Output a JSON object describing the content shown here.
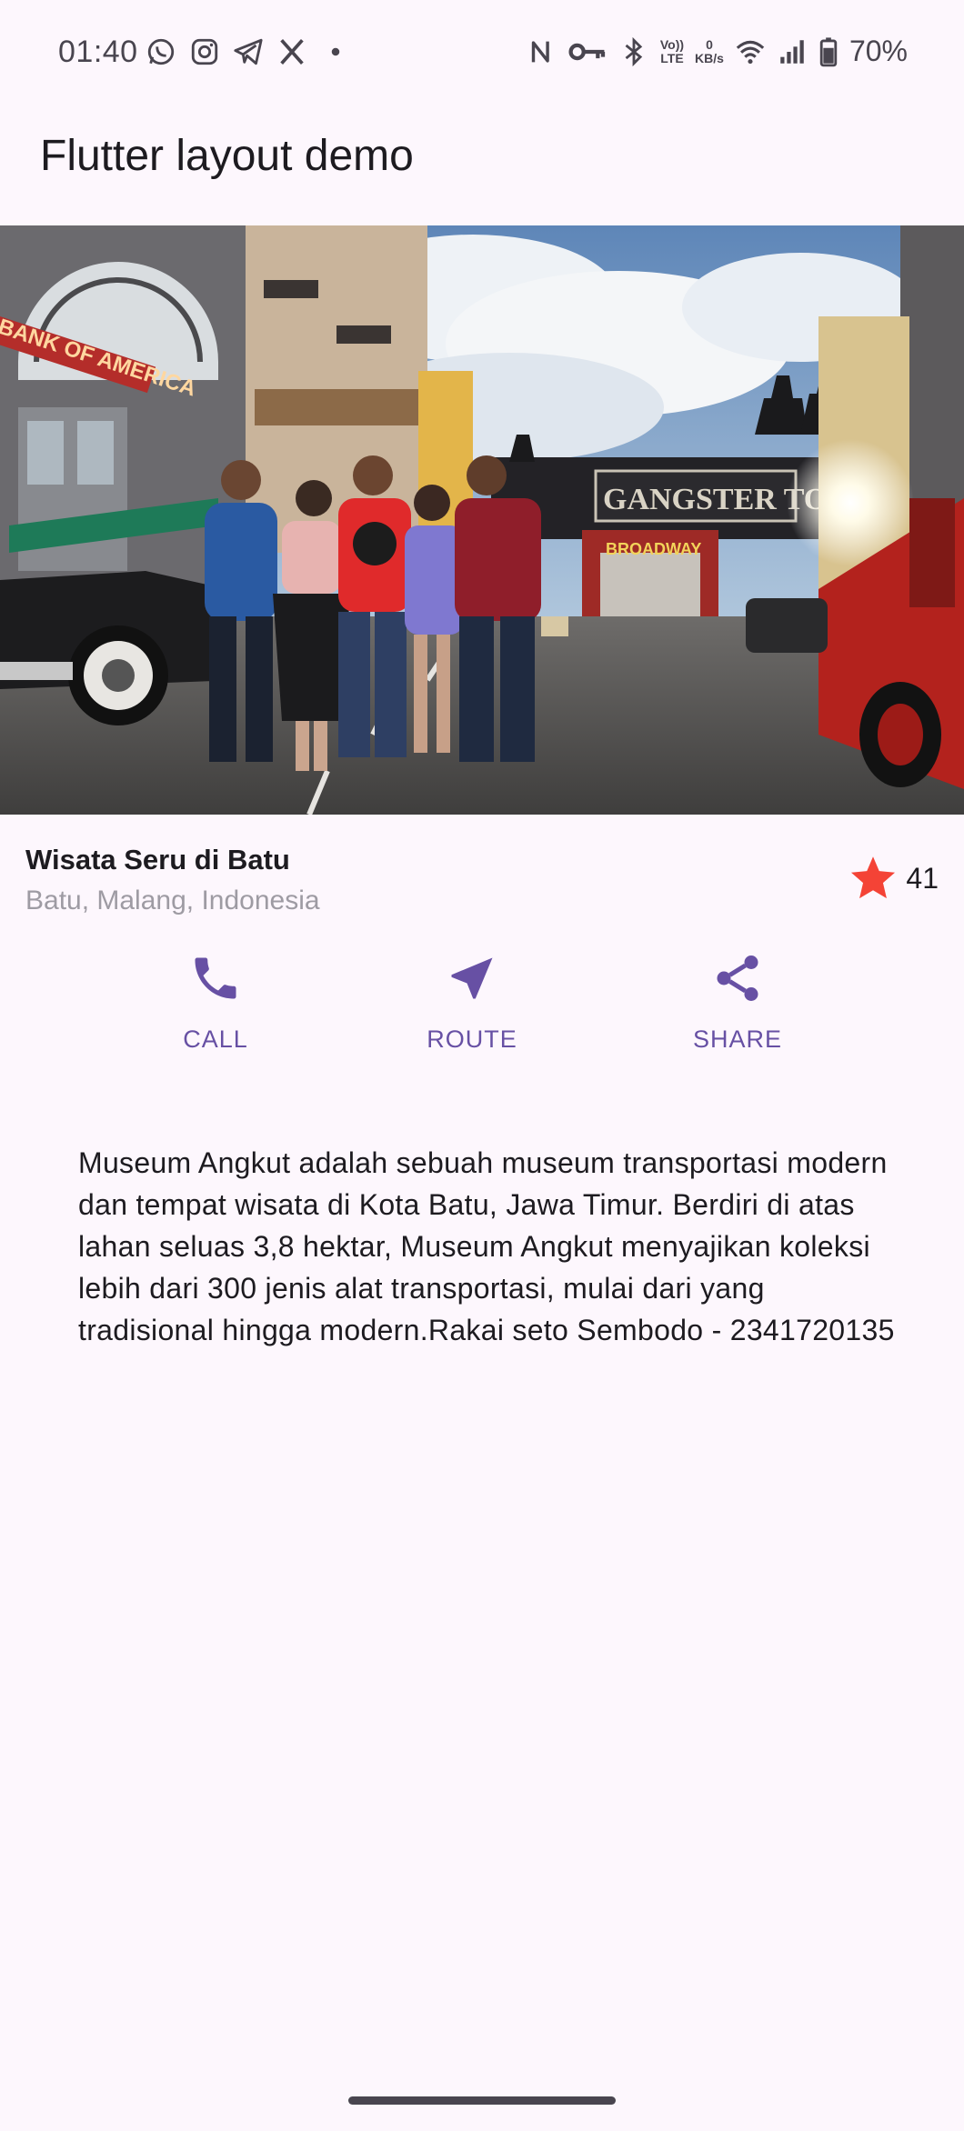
{
  "status_bar": {
    "time": "01:40",
    "battery": "70%",
    "data_rate_value": "0",
    "data_rate_unit": "KB/s",
    "volte_top": "Vo))",
    "volte_bottom": "LTE",
    "left_icons": [
      "whatsapp-icon",
      "instagram-icon",
      "telegram-icon",
      "x-icon",
      "dot-icon"
    ],
    "right_icons": [
      "nfc-icon",
      "key-icon",
      "bluetooth-icon",
      "volte-icon",
      "data-rate",
      "wifi-icon",
      "signal-icon",
      "battery-icon"
    ]
  },
  "app_bar": {
    "title": "Flutter layout demo"
  },
  "hero_image": {
    "signage": {
      "bank": "BANK OF AMERICA",
      "gate": "GANGSTER TOWN",
      "theater": "BROADWAY"
    }
  },
  "title_section": {
    "title": "Wisata Seru di Batu",
    "subtitle": "Batu, Malang, Indonesia",
    "rating_count": "41",
    "star_color": "#f44336"
  },
  "actions": [
    {
      "label": "CALL",
      "icon": "phone-icon"
    },
    {
      "label": "ROUTE",
      "icon": "navigation-icon"
    },
    {
      "label": "SHARE",
      "icon": "share-icon"
    }
  ],
  "accent_color": "#6750a4",
  "description": "Museum Angkut adalah sebuah museum transportasi modern dan tempat wisata di Kota Batu, Jawa Timur. Berdiri di atas lahan seluas 3,8 hektar, Museum Angkut menyajikan koleksi lebih dari 300 jenis alat transportasi, mulai dari yang tradisional hingga modern.Rakai seto Sembodo - 2341720135"
}
